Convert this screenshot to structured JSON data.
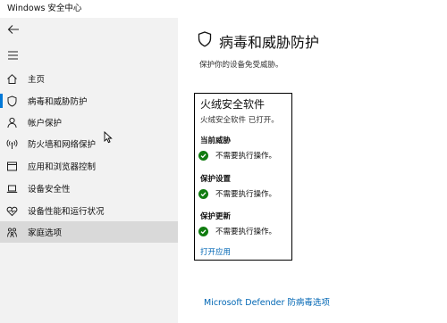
{
  "window": {
    "title": "Windows 安全中心"
  },
  "sidebar": {
    "back_icon": "back-arrow-icon",
    "menu_icon": "hamburger-menu-icon",
    "items": [
      {
        "label": "主页",
        "icon": "home-icon"
      },
      {
        "label": "病毒和威胁防护",
        "icon": "shield-icon"
      },
      {
        "label": "帐户保护",
        "icon": "person-icon"
      },
      {
        "label": "防火墙和网络保护",
        "icon": "antenna-icon"
      },
      {
        "label": "应用和浏览器控制",
        "icon": "app-window-icon"
      },
      {
        "label": "设备安全性",
        "icon": "laptop-icon"
      },
      {
        "label": "设备性能和运行状况",
        "icon": "heart-icon"
      },
      {
        "label": "家庭选项",
        "icon": "family-icon"
      }
    ]
  },
  "main": {
    "title": "病毒和威胁防护",
    "title_icon": "shield-icon",
    "subtitle": "保护你的设备免受威胁。",
    "antivirus": {
      "name": "火绒安全软件",
      "status": "火绒安全软件 已打开。",
      "sections": [
        {
          "title": "当前威胁",
          "status": "不需要执行操作。"
        },
        {
          "title": "保护设置",
          "status": "不需要执行操作。"
        },
        {
          "title": "保护更新",
          "status": "不需要执行操作。"
        }
      ],
      "open_app_link": "打开应用"
    },
    "defender_link": "Microsoft Defender 防病毒选项"
  },
  "colors": {
    "accent": "#0078d7",
    "link": "#0066b4",
    "ok_green": "#107c10",
    "sidebar_bg": "#f2f2f2",
    "selected_bg": "#d9d9d9"
  }
}
